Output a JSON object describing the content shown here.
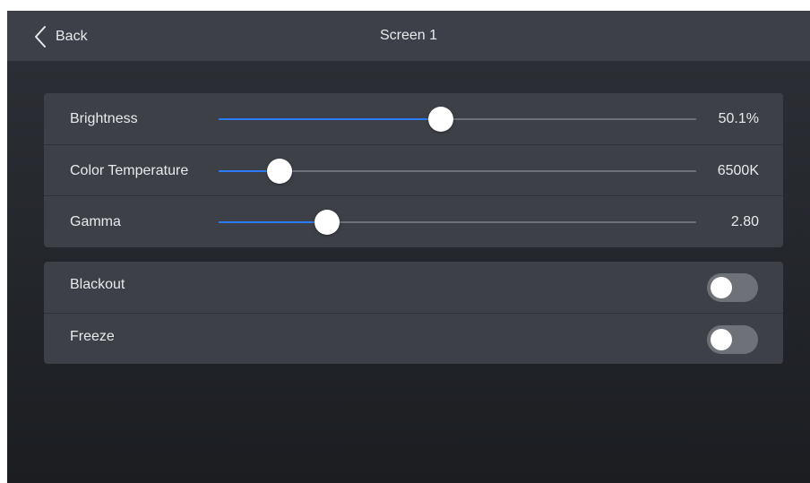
{
  "topbar": {
    "back_label": "Back",
    "title": "Screen 1"
  },
  "sliders": [
    {
      "label": "Brightness",
      "value_text": "50.1%",
      "fraction": 0.466
    },
    {
      "label": "Color Temperature",
      "value_text": "6500K",
      "fraction": 0.128
    },
    {
      "label": "Gamma",
      "value_text": "2.80",
      "fraction": 0.227
    }
  ],
  "toggles": [
    {
      "label": "Blackout",
      "on": false
    },
    {
      "label": "Freeze",
      "on": false
    }
  ],
  "colors": {
    "accent": "#2b7cf6",
    "panel": "#3d4047",
    "topbar": "#3d4048",
    "track": "#6e7178",
    "text": "#e9eaec"
  },
  "icons": {
    "back": "chevron-left-icon"
  }
}
